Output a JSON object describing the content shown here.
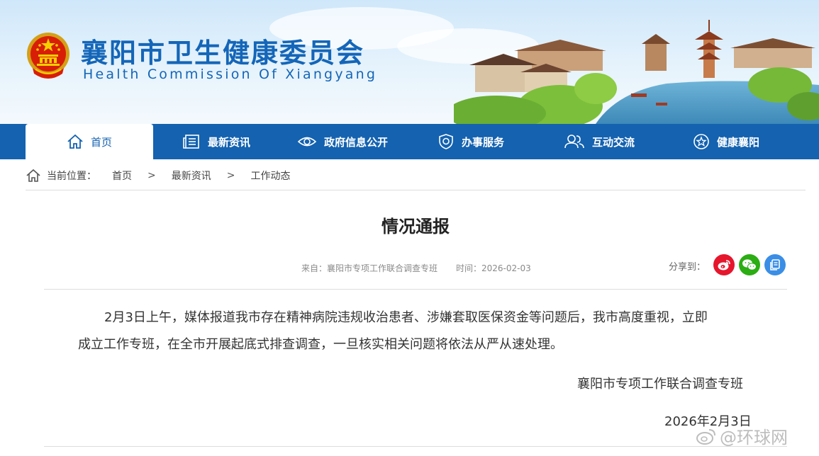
{
  "header": {
    "title": "襄阳市卫生健康委员会",
    "subtitle": "Health Commission Of Xiangyang"
  },
  "nav": {
    "items": [
      {
        "label": "首页",
        "icon": "home-icon"
      },
      {
        "label": "最新资讯",
        "icon": "newspaper-icon"
      },
      {
        "label": "政府信息公开",
        "icon": "eye-icon"
      },
      {
        "label": "办事服务",
        "icon": "shield-icon"
      },
      {
        "label": "互动交流",
        "icon": "users-icon"
      },
      {
        "label": "健康襄阳",
        "icon": "star-icon"
      }
    ],
    "active": "首页"
  },
  "breadcrumb": {
    "label": "当前位置：",
    "items": [
      "首页",
      "最新资讯",
      "工作动态"
    ],
    "separator": ">"
  },
  "article": {
    "title": "情况通报",
    "source": "来自：襄阳市专项工作联合调查专班",
    "time": "时间：2026-02-03",
    "share_label": "分享到：",
    "paragraph_line1": "2月3日上午，媒体报道我市存在精神病院违规收治患者、涉嫌套取医保资金等问题后，我市高度重视，立即",
    "paragraph_line2": "成立工作专班，在全市开展起底式排查调查，一旦核实相关问题将依法从严从速处理。",
    "signature": "襄阳市专项工作联合调查专班",
    "date": "2026年2月3日"
  },
  "share": {
    "buttons": [
      "weibo-icon",
      "wechat-icon",
      "copy-icon"
    ],
    "colors": {
      "weibo": "#e6162d",
      "wechat": "#2bad13",
      "copy": "#3a8ee6"
    }
  },
  "watermark": {
    "text": "@环球网"
  },
  "colors": {
    "brand": "#1462b0",
    "title": "#1466b8"
  }
}
